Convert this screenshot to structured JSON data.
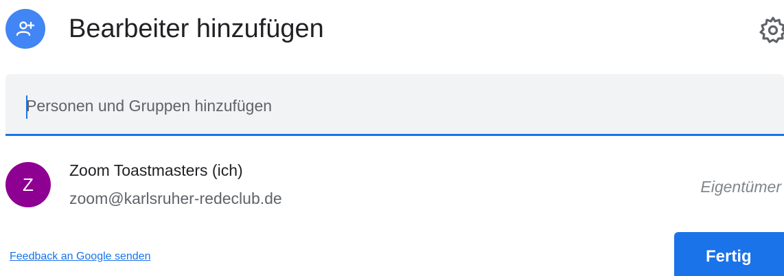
{
  "header": {
    "title": "Bearbeiter hinzufügen",
    "add_person_icon": "person-add-icon",
    "settings_icon": "gear-icon"
  },
  "search": {
    "placeholder": "Personen und Gruppen hinzufügen",
    "value": ""
  },
  "people": [
    {
      "avatar_letter": "Z",
      "name": "Zoom Toastmasters (ich)",
      "email": "zoom@karlsruher-redeclub.de",
      "role": "Eigentümer"
    }
  ],
  "footer": {
    "feedback_link": "Feedback an Google senden",
    "done_label": "Fertig"
  },
  "colors": {
    "accent": "#1a73e8",
    "header_icon_bg": "#4285f4",
    "avatar_bg": "#8e0092",
    "input_bg": "#f1f3f4"
  }
}
